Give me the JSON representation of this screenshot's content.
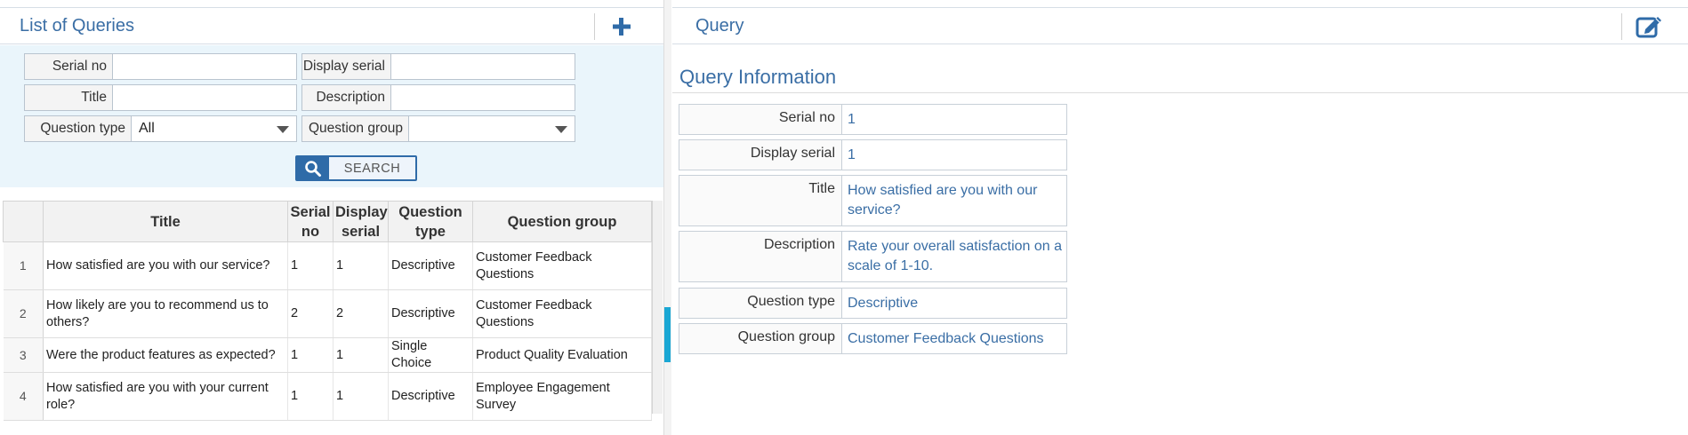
{
  "left": {
    "title": "List of Queries",
    "filters": {
      "serial_no": {
        "label": "Serial no",
        "value": ""
      },
      "display_serial": {
        "label": "Display serial",
        "value": ""
      },
      "title": {
        "label": "Title",
        "value": ""
      },
      "description": {
        "label": "Description",
        "value": ""
      },
      "question_type": {
        "label": "Question type",
        "value": "All"
      },
      "question_group": {
        "label": "Question group",
        "value": ""
      }
    },
    "search_label": "SEARCH",
    "table": {
      "columns": [
        "Title",
        "Serial no",
        "Display serial",
        "Question type",
        "Question group"
      ],
      "rows": [
        {
          "idx": "1",
          "title": "How satisfied are you with our service?",
          "serial": "1",
          "display": "1",
          "type": "Descriptive",
          "group": "Customer Feedback Questions"
        },
        {
          "idx": "2",
          "title": "How likely are you to recommend us to others?",
          "serial": "2",
          "display": "2",
          "type": "Descriptive",
          "group": "Customer Feedback Questions"
        },
        {
          "idx": "3",
          "title": "Were the product features as expected?",
          "serial": "1",
          "display": "1",
          "type": "Single Choice",
          "group": "Product Quality Evaluation"
        },
        {
          "idx": "4",
          "title": "How satisfied are you with your current role?",
          "serial": "1",
          "display": "1",
          "type": "Descriptive",
          "group": "Employee Engagement Survey"
        }
      ]
    }
  },
  "right": {
    "title": "Query",
    "section_title": "Query Information",
    "fields": [
      {
        "label": "Serial no",
        "value": "1"
      },
      {
        "label": "Display serial",
        "value": "1"
      },
      {
        "label": "Title",
        "value": "How satisfied are you with our service?"
      },
      {
        "label": "Description",
        "value": "Rate your overall satisfaction on a scale of 1-10."
      },
      {
        "label": "Question type",
        "value": "Descriptive"
      },
      {
        "label": "Question group",
        "value": "Customer Feedback Questions"
      }
    ]
  },
  "colors": {
    "accent": "#3a6ea5",
    "button_blue": "#2f6ba8",
    "filter_bg": "#eaf5fb",
    "splitter_handle": "#1aa7d4"
  },
  "icons": {
    "add": "plus-icon",
    "search": "magnifier-icon",
    "edit": "edit-icon",
    "dropdown": "chevron-down-icon"
  }
}
